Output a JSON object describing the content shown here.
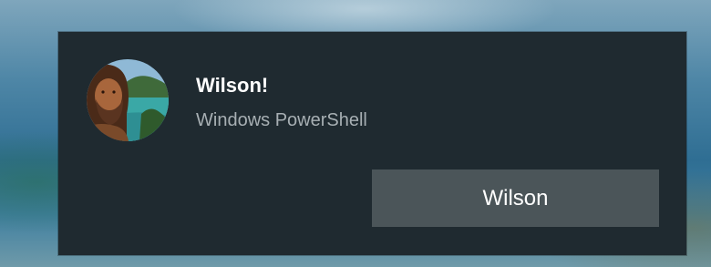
{
  "toast": {
    "title": "Wilson!",
    "app_name": "Windows PowerShell",
    "action_label": "Wilson",
    "avatar_icon": "user-avatar-icon"
  },
  "colors": {
    "toast_background": "#1f2a30",
    "button_background": "#4b5559",
    "title_text": "#ffffff",
    "subtitle_text": "#a7afb3"
  }
}
